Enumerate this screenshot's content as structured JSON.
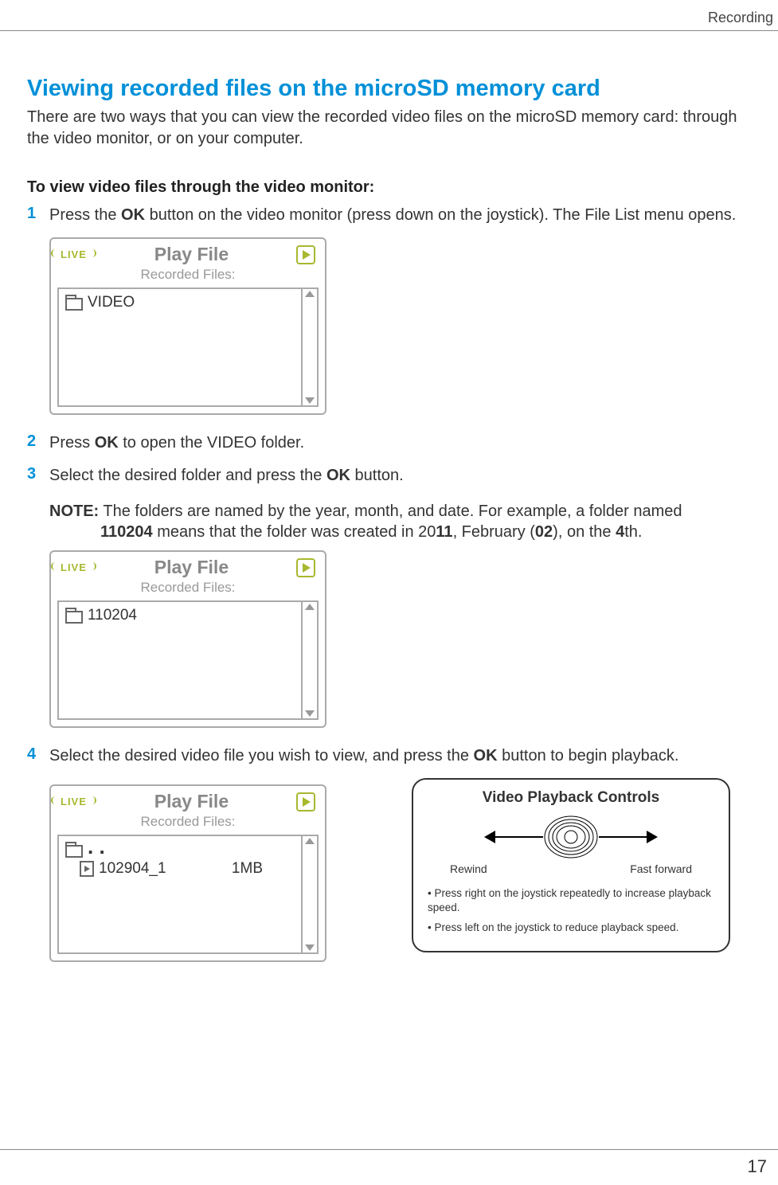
{
  "header": {
    "section": "Recording"
  },
  "page_number": "17",
  "h1": "Viewing recorded files on the microSD memory card",
  "intro": "There are two ways that you can view the recorded video files on the microSD memory card: through the video monitor, or on your computer.",
  "sub_head": "To view video files through the video monitor:",
  "steps": {
    "s1_pre": "Press the ",
    "s1_bold": "OK",
    "s1_post": " button on the video monitor (press down on the joystick). The File List menu opens.",
    "s2_pre": "Press ",
    "s2_bold": "OK",
    "s2_post": " to open the VIDEO folder.",
    "s3_pre": "Select the desired folder and press the ",
    "s3_bold": "OK",
    "s3_post": " button.",
    "s4_pre": "Select the desired video file you wish to view, and press the ",
    "s4_bold": "OK",
    "s4_post": " button to begin playback."
  },
  "note": {
    "label": "NOTE:",
    "line1_a": " The folders are named by the year, month, and date. For example, a folder named ",
    "b1": "110204",
    "line1_b": " means that the folder was created in 20",
    "b2": "11",
    "line1_c": ", February (",
    "b3": "02",
    "line1_d": "), on the ",
    "b4": "4",
    "line1_e": "th."
  },
  "playfile": {
    "live": "LIVE",
    "title": "Play File",
    "subtitle": "Recorded Files:",
    "folder1": "VIDEO",
    "folder2": "110204",
    "dots": ". .",
    "file": "102904_1",
    "size": "1MB"
  },
  "vpc": {
    "title": "Video Playback Controls",
    "left": "Rewind",
    "right": "Fast forward",
    "b1": "• Press right on the joystick repeatedly to increase playback speed.",
    "b2": "• Press left on the joystick to reduce playback speed."
  }
}
